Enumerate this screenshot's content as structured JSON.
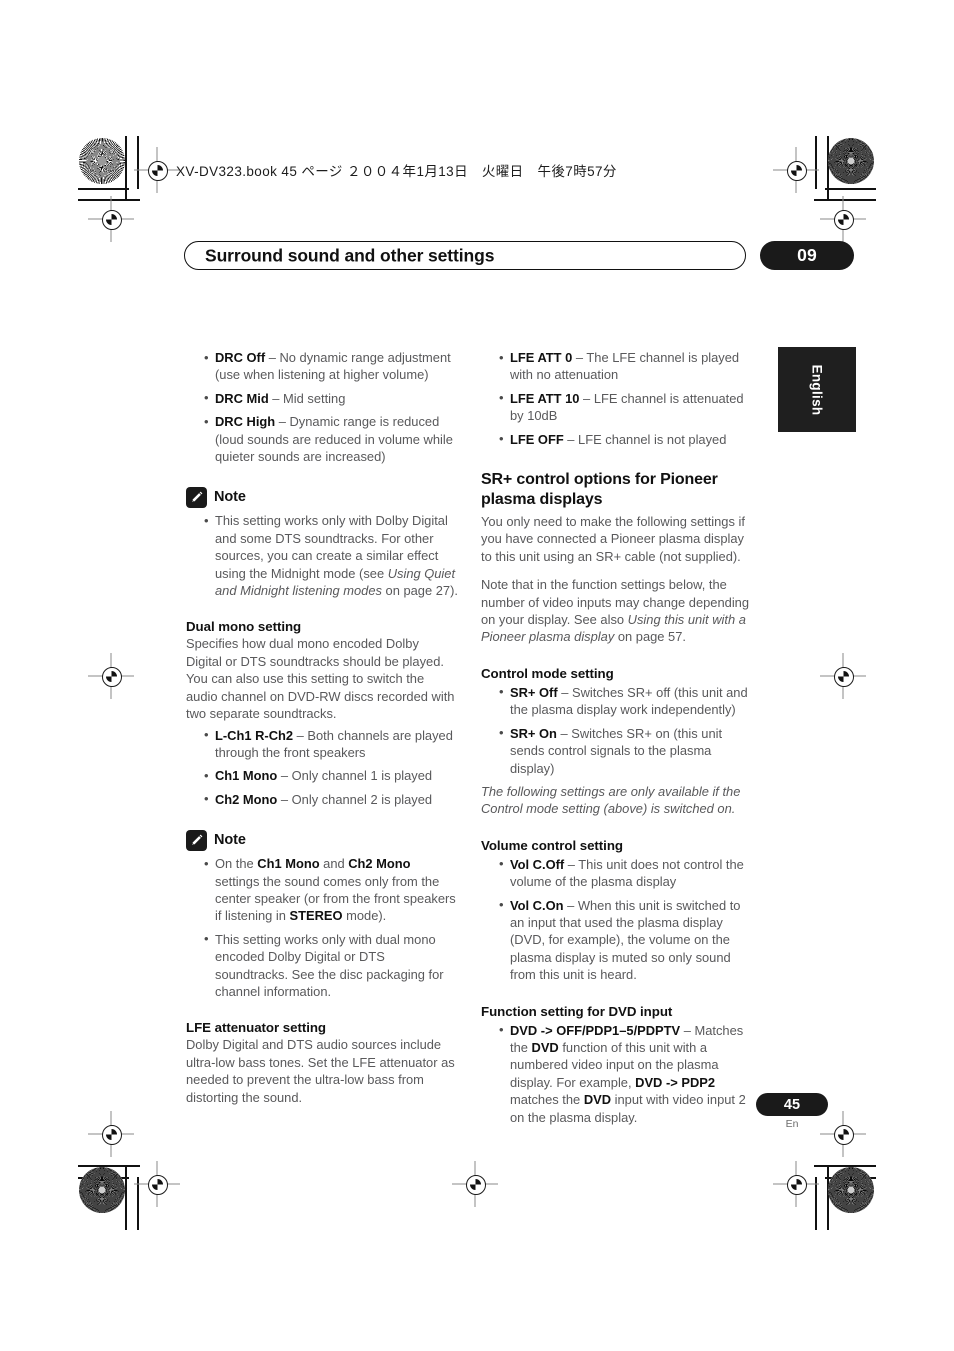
{
  "slug": "XV-DV323.book  45 ページ  ２００４年1月13日　火曜日　午後7時57分",
  "header": {
    "title": "Surround sound and other settings",
    "chapter_number": "09"
  },
  "side_tab": {
    "label": "English"
  },
  "footer": {
    "page_number": "45",
    "language_code": "En"
  },
  "note_label": "Note",
  "left_column": {
    "drc_bullets": [
      {
        "term": "DRC Off",
        "dash": " – ",
        "desc": "No dynamic range adjustment (use when listening at higher volume)"
      },
      {
        "term": "DRC Mid",
        "dash": " – ",
        "desc": "Mid setting"
      },
      {
        "term": "DRC High",
        "dash": " – ",
        "desc": "Dynamic range is reduced (loud sounds are reduced in volume while quieter sounds are increased)"
      }
    ],
    "note1_text_a": "This setting works only with Dolby Digital and some DTS soundtracks. For other sources, you can create a similar effect using the Midnight mode (see ",
    "note1_italic": "Using Quiet and Midnight listening modes",
    "note1_text_b": " on page 27).",
    "dual_mono": {
      "heading": "Dual mono setting",
      "body": "Specifies how dual mono encoded Dolby Digital or DTS soundtracks should be played. You can also use this setting to switch the audio channel on DVD-RW discs recorded with two separate soundtracks.",
      "bullets": [
        {
          "term": "L-Ch1 R-Ch2",
          "dash": " – ",
          "desc": "Both channels are played through the front speakers"
        },
        {
          "term": "Ch1 Mono",
          "dash": " – ",
          "desc": "Only channel 1 is played"
        },
        {
          "term": "Ch2 Mono",
          "dash": " – ",
          "desc": "Only channel 2 is played"
        }
      ]
    },
    "note2": {
      "b1_a": "On the ",
      "b1_t1": "Ch1 Mono",
      "b1_b": " and ",
      "b1_t2": "Ch2 Mono",
      "b1_c": " settings the sound comes only from the center speaker (or from the front speakers if listening in ",
      "b1_t3": "STEREO",
      "b1_d": " mode).",
      "b2": "This setting works only with dual mono encoded Dolby Digital or DTS soundtracks. See the disc packaging for channel information."
    },
    "lfe_att": {
      "heading": "LFE attenuator setting",
      "body": "Dolby Digital and DTS audio sources include ultra-low bass tones. Set the LFE attenuator as needed to prevent the ultra-low bass from distorting the sound."
    }
  },
  "right_column": {
    "lfe_bullets": [
      {
        "term": "LFE ATT 0",
        "dash": " – ",
        "desc": "The LFE channel is played with no attenuation"
      },
      {
        "term": "LFE ATT 10",
        "dash": " – ",
        "desc": "LFE channel is attenuated by 10dB"
      },
      {
        "term": "LFE OFF",
        "dash": " – ",
        "desc": "LFE channel is not played"
      }
    ],
    "sr_plus": {
      "heading": "SR+ control options for Pioneer plasma displays",
      "para1": "You only need to make the following settings if you have connected a Pioneer plasma display to this unit using an SR+ cable (not supplied).",
      "para2_a": "Note that in the function settings below, the number of video inputs may change depending on your display. See also ",
      "para2_italic": "Using this unit with a Pioneer plasma display",
      "para2_b": " on page 57."
    },
    "control_mode": {
      "heading": "Control mode setting",
      "bullets": [
        {
          "term": "SR+ Off",
          "dash": " – ",
          "desc": "Switches SR+ off (this unit and the plasma display work independently)"
        },
        {
          "term": "SR+ On",
          "dash": " – ",
          "desc": "Switches SR+ on (this unit sends control signals to the plasma display)"
        }
      ],
      "italic_note": "The following settings are only available if the Control mode setting (above) is switched on."
    },
    "volume_control": {
      "heading": "Volume control setting",
      "bullets": [
        {
          "term": "Vol C.Off",
          "dash": " – ",
          "desc": "This unit does not control the volume of the plasma display"
        },
        {
          "term": "Vol C.On",
          "dash": " – ",
          "desc": "When this unit is switched to an input that used the plasma display (DVD, for example), the volume on the plasma display is muted so only sound from this unit is heard."
        }
      ]
    },
    "function_setting": {
      "heading": "Function setting for DVD input",
      "b_term": "DVD -> OFF/PDP1–5/PDPTV",
      "b_dash": " – ",
      "b_a": "Matches the ",
      "b_t1": "DVD",
      "b_b": " function of this unit with a numbered video input on the plasma display. For example, ",
      "b_t2": "DVD -> PDP2",
      "b_c": " matches the ",
      "b_t3": "DVD",
      "b_d": " input with video input 2 on the plasma display."
    }
  }
}
